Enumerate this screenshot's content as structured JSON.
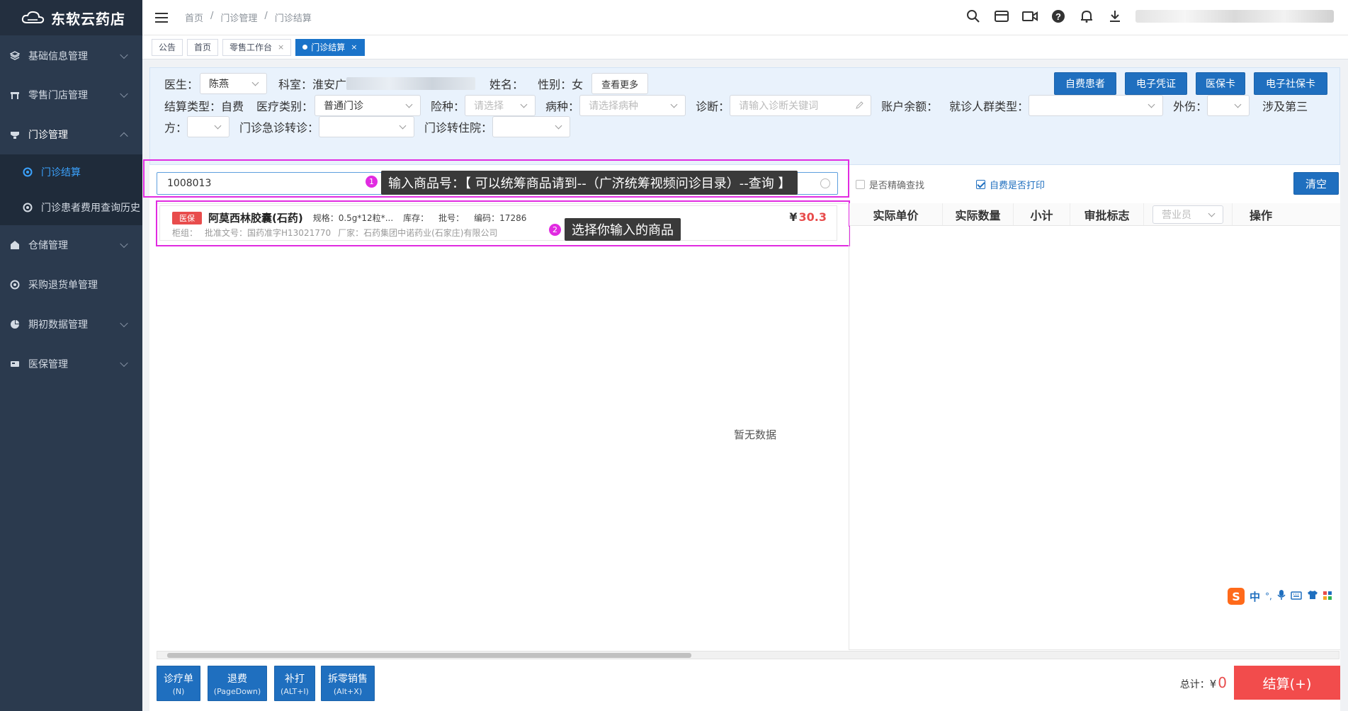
{
  "app": {
    "name": "东软云药店"
  },
  "sidebar": {
    "items": [
      {
        "label": "基础信息管理",
        "icon": "cube-icon"
      },
      {
        "label": "零售门店管理",
        "icon": "store-icon"
      },
      {
        "label": "门诊管理",
        "icon": "stethoscope-icon"
      },
      {
        "label": "门诊结算",
        "icon": "settle-icon"
      },
      {
        "label": "门诊患者费用查询历史",
        "icon": "history-icon"
      },
      {
        "label": "仓储管理",
        "icon": "warehouse-icon"
      },
      {
        "label": "采购退货单管理",
        "icon": "return-icon"
      },
      {
        "label": "期初数据管理",
        "icon": "pie-icon"
      },
      {
        "label": "医保管理",
        "icon": "card-icon"
      }
    ]
  },
  "breadcrumb": {
    "home": "首页",
    "sep1": "/",
    "section": "门诊管理",
    "sep2": "/",
    "page": "门诊结算"
  },
  "tabs": {
    "notice": "公告",
    "home": "首页",
    "retail": "零售工作台",
    "close1": "×",
    "current": "门诊结算",
    "close2": "×"
  },
  "form": {
    "doctor_label": "医生：",
    "doctor_value": "陈燕",
    "dept_label": "科室：",
    "dept_value": "淮安广",
    "name_label": "姓名：",
    "gender_label": "性别：女",
    "more_btn": "查看更多",
    "settle_type": "结算类型：自费",
    "med_cat_label": "医疗类别：",
    "med_cat_value": "普通门诊",
    "insurance_label": "险种：",
    "insurance_ph": "请选择",
    "disease_label": "病种：",
    "disease_ph": "请选择病种",
    "diag_label": "诊断：",
    "diag_ph": "请输入诊断关键词",
    "balance_label": "账户余额：",
    "crowd_label": "就诊人群类型：",
    "injury_label": "外伤：",
    "third_label": "涉及第三",
    "third_label2": "方：",
    "er_label": "门诊急诊转诊：",
    "hosp_label": "门诊转住院："
  },
  "actions": {
    "self_pay": "自费患者",
    "e_voucher": "电子凭证",
    "ins_card": "医保卡",
    "e_social": "电子社保卡"
  },
  "search": {
    "value": "1008013",
    "exact_label": "是否精确查找",
    "print_label": "自费是否打印",
    "clear": "清空"
  },
  "annotations": {
    "n1": "1",
    "tip1": "输入商品号：【 可以统筹商品请到--（广济统筹视频问诊目录）--查询 】",
    "n2": "2",
    "tip2": "选择你输入的商品"
  },
  "product": {
    "badge": "医保",
    "name": "阿莫西林胶囊(石药)",
    "spec": "规格：0.5g*12粒*...",
    "stock": "库存：",
    "batch": "批号：",
    "code": "编码：17286",
    "price_symbol": "¥",
    "price": "30.3",
    "cabinet": "柜组：",
    "approval": "批准文号：国药准字H13021770",
    "maker": "厂家：石药集团中诺药业(石家庄)有限公司"
  },
  "table": {
    "headers": [
      "实际单价",
      "实际数量",
      "小计",
      "审批标志"
    ],
    "salesman_ph": "营业员",
    "op": "操作",
    "empty": "暂无数据"
  },
  "bottom": {
    "buttons": [
      {
        "label": "诊疗单",
        "key": "(N)"
      },
      {
        "label": "退费",
        "key": "(PageDown)"
      },
      {
        "label": "补打",
        "key": "(ALT+I)"
      },
      {
        "label": "拆零销售",
        "key": "(Alt+X)"
      }
    ],
    "total_label": "总计：",
    "total_symbol": "¥",
    "total_value": "0",
    "settle": "结算(+)"
  },
  "ime": {
    "logo": "S",
    "lang": "中",
    "punct": "°,"
  },
  "colors": {
    "sidebar": "#2b3a4e",
    "primary": "#1f6fbf",
    "danger": "#f24c4c",
    "highlight": "#e12be1",
    "active_menu": "#3ba3ff"
  }
}
